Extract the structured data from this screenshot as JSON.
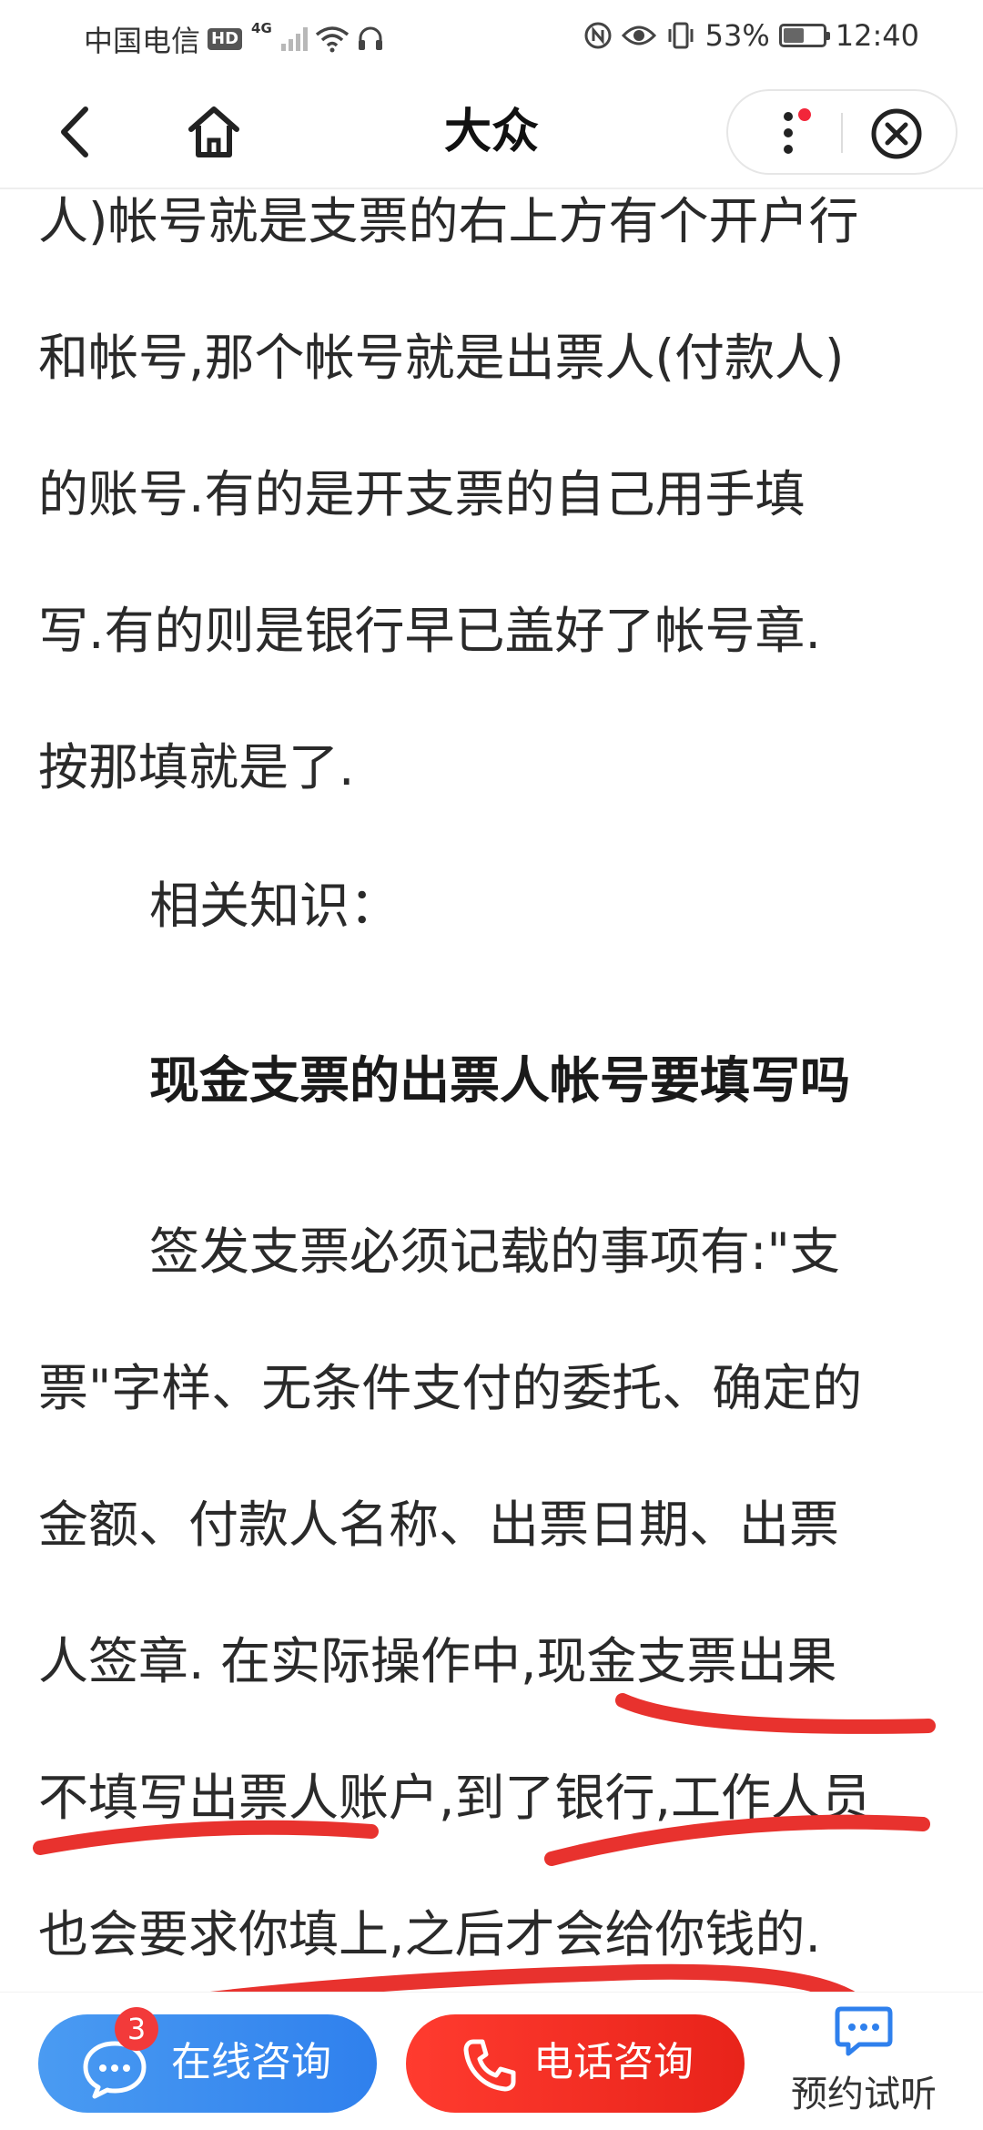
{
  "status_bar": {
    "carrier": "中国电信",
    "hd": "HD",
    "network": "4G",
    "battery_percent": "53%",
    "battery_level": 0.53,
    "time": "12:40"
  },
  "nav": {
    "title": "大众"
  },
  "article": {
    "lines": [
      "人)帐号就是支票的右上方有个开户行",
      "和帐号,那个帐号就是出票人(付款人)",
      "的账号.有的是开支票的自己用手填",
      "写.有的则是银行早已盖好了帐号章.",
      "按那填就是了.",
      "相关知识：",
      "现金支票的出票人帐号要填写吗",
      "签发支票必须记载的事项有:\"支",
      "票\"字样、无条件支付的委托、确定的",
      "金额、付款人名称、出票日期、出票",
      "人签章. 在实际操作中,现金支票出果",
      "不填写出票人账户,到了银行,工作人员",
      "也会要求你填上,之后才会给你钱的."
    ]
  },
  "bottom_bar": {
    "online_label": "在线咨询",
    "online_badge": "3",
    "phone_label": "电话咨询",
    "trial_label": "预约试听"
  },
  "colors": {
    "online_blue": "#2f80ed",
    "phone_red": "#e8231a",
    "annotation_red": "#e8322e",
    "badge_red": "#f23a3a"
  },
  "icons": [
    "signal-icon",
    "wifi-icon",
    "headset-icon",
    "nfc-icon",
    "eye-icon",
    "vibrate-icon",
    "battery-icon",
    "back-icon",
    "home-icon",
    "more-icon",
    "close-icon",
    "chat-icon",
    "phone-icon",
    "message-icon"
  ]
}
